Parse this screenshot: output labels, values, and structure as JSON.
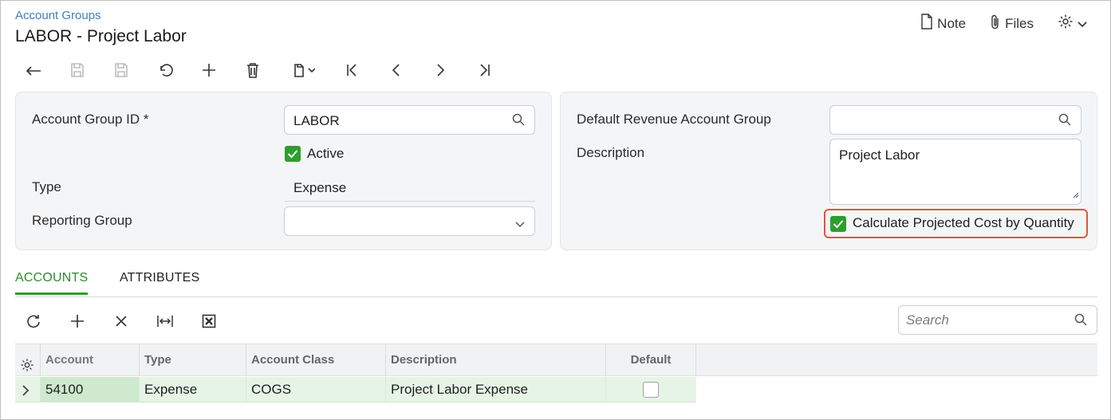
{
  "header": {
    "breadcrumb": "Account Groups",
    "title": "LABOR - Project Labor",
    "note_label": "Note",
    "files_label": "Files"
  },
  "toolbar": {
    "buttons": [
      "undo-back",
      "save-close",
      "save",
      "cancel",
      "add",
      "delete",
      "copy-paste",
      "first",
      "previous",
      "next",
      "last"
    ]
  },
  "form_left": {
    "account_group_id_label": "Account Group ID *",
    "account_group_id_value": "LABOR",
    "active_label": "Active",
    "active_checked": true,
    "type_label": "Type",
    "type_value": "Expense",
    "reporting_group_label": "Reporting Group",
    "reporting_group_value": ""
  },
  "form_right": {
    "default_revenue_label": "Default Revenue Account Group",
    "default_revenue_value": "",
    "description_label": "Description",
    "description_value": "Project Labor",
    "calc_projected_label": "Calculate Projected Cost by Quantity",
    "calc_projected_checked": true
  },
  "tabs": {
    "accounts": "ACCOUNTS",
    "attributes": "ATTRIBUTES",
    "active": "accounts"
  },
  "grid": {
    "search_placeholder": "Search",
    "columns": {
      "account": "Account",
      "type": "Type",
      "account_class": "Account Class",
      "description": "Description",
      "default": "Default"
    },
    "rows": [
      {
        "account": "54100",
        "type": "Expense",
        "account_class": "COGS",
        "description": "Project Labor Expense",
        "default": false
      }
    ]
  },
  "colors": {
    "accent_green": "#2e9e2e",
    "link_blue": "#3f7fbf",
    "highlight_red": "#e0573a",
    "row_selected": "#e6f4e6"
  }
}
